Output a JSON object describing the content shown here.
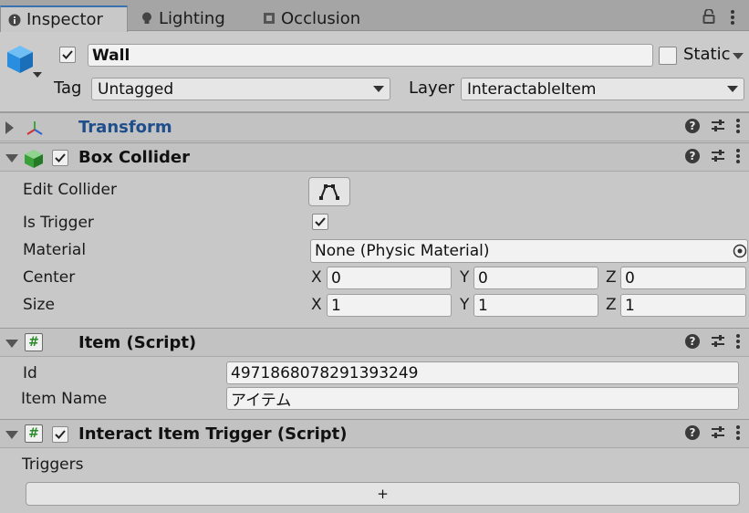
{
  "tabs": [
    {
      "label": "Inspector",
      "icon": "info-icon"
    },
    {
      "label": "Lighting",
      "icon": "lightbulb-icon"
    },
    {
      "label": "Occlusion",
      "icon": "occlusion-icon"
    }
  ],
  "header": {
    "object_name": "Wall",
    "static_label": "Static",
    "tag_label": "Tag",
    "tag_value": "Untagged",
    "layer_label": "Layer",
    "layer_value": "InteractableItem"
  },
  "transform": {
    "title": "Transform"
  },
  "box_collider": {
    "title": "Box Collider",
    "edit_collider_label": "Edit Collider",
    "is_trigger_label": "Is Trigger",
    "material_label": "Material",
    "material_value": "None (Physic Material)",
    "center_label": "Center",
    "center": {
      "x": "0",
      "y": "0",
      "z": "0"
    },
    "size_label": "Size",
    "size": {
      "x": "1",
      "y": "1",
      "z": "1"
    },
    "axis_x": "X",
    "axis_y": "Y",
    "axis_z": "Z"
  },
  "item_script": {
    "title": "Item (Script)",
    "id_label": "Id",
    "id_value": "4971868078291393249",
    "item_name_label": "Item Name",
    "item_name_value": "アイテム"
  },
  "interact_script": {
    "title": "Interact Item Trigger (Script)",
    "triggers_label": "Triggers",
    "add_label": "+"
  },
  "icons": {
    "help": "?"
  },
  "colors": {
    "transform_title": "#1f4e8c",
    "cube_blue": "#2a8ee0",
    "script_green": "#2a8a2a"
  }
}
